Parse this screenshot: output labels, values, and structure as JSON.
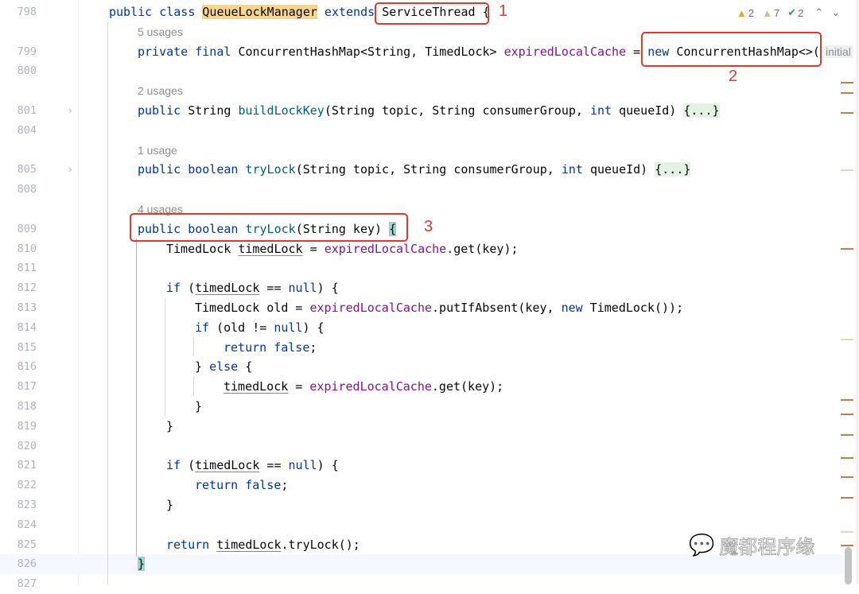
{
  "inspections": {
    "warnings": "2",
    "weak_warnings": "7",
    "typos": "2"
  },
  "annotations": [
    "1",
    "2",
    "3"
  ],
  "watermark": "魔都程序缘",
  "hint": "initial",
  "rows": [
    {
      "n": "798",
      "i": 0,
      "t": [
        [
          "k",
          "public class "
        ],
        [
          "cls",
          "QueueLockManager"
        ],
        [
          "k",
          " extends "
        ],
        [
          "p",
          "ServiceThread {"
        ]
      ]
    },
    {
      "usage": "5 usages",
      "i": 1
    },
    {
      "n": "799",
      "i": 1,
      "t": [
        [
          "k",
          "private final "
        ],
        [
          "p",
          "ConcurrentHashMap<String, TimedLock> "
        ],
        [
          "f",
          "expiredLocalCache"
        ],
        [
          "p",
          " = "
        ],
        [
          "k",
          "new "
        ],
        [
          "p",
          "ConcurrentHashMap<>("
        ]
      ],
      "hint": true
    },
    {
      "n": "800",
      "i": 1,
      "t": []
    },
    {
      "usage": "2 usages",
      "i": 1
    },
    {
      "n": "801",
      "i": 1,
      "fold": true,
      "t": [
        [
          "k",
          "public "
        ],
        [
          "p",
          "String "
        ],
        [
          "m",
          "buildLockKey"
        ],
        [
          "p",
          "(String topic, String consumerGroup, "
        ],
        [
          "k",
          "int "
        ],
        [
          "p",
          "queueId) "
        ],
        [
          "fb",
          "{...}"
        ]
      ]
    },
    {
      "n": "804",
      "i": 1,
      "t": []
    },
    {
      "usage": "1 usage",
      "i": 1
    },
    {
      "n": "805",
      "i": 1,
      "fold": true,
      "t": [
        [
          "k",
          "public boolean "
        ],
        [
          "m",
          "tryLock"
        ],
        [
          "p",
          "(String topic, String consumerGroup, "
        ],
        [
          "k",
          "int "
        ],
        [
          "p",
          "queueId) "
        ],
        [
          "fb",
          "{...}"
        ]
      ]
    },
    {
      "n": "808",
      "i": 1,
      "t": []
    },
    {
      "usage": "4 usages",
      "i": 1
    },
    {
      "n": "809",
      "i": 1,
      "t": [
        [
          "k",
          "public boolean "
        ],
        [
          "m",
          "tryLock"
        ],
        [
          "p",
          "(String key) "
        ],
        [
          "hl",
          "{"
        ]
      ]
    },
    {
      "n": "810",
      "i": 2,
      "t": [
        [
          "p",
          "TimedLock "
        ],
        [
          "v",
          "timedLock"
        ],
        [
          "p",
          " = "
        ],
        [
          "f",
          "expiredLocalCache"
        ],
        [
          "p",
          ".get(key);"
        ]
      ]
    },
    {
      "n": "811",
      "i": 2,
      "t": []
    },
    {
      "n": "812",
      "i": 2,
      "t": [
        [
          "k",
          "if "
        ],
        [
          "p",
          "("
        ],
        [
          "v",
          "timedLock"
        ],
        [
          "p",
          " == "
        ],
        [
          "k",
          "null"
        ],
        [
          "p",
          ") {"
        ]
      ]
    },
    {
      "n": "813",
      "i": 3,
      "t": [
        [
          "p",
          "TimedLock old = "
        ],
        [
          "f",
          "expiredLocalCache"
        ],
        [
          "p",
          ".putIfAbsent(key, "
        ],
        [
          "k",
          "new "
        ],
        [
          "p",
          "TimedLock());"
        ]
      ]
    },
    {
      "n": "814",
      "i": 3,
      "t": [
        [
          "k",
          "if "
        ],
        [
          "p",
          "(old != "
        ],
        [
          "k",
          "null"
        ],
        [
          "p",
          ") {"
        ]
      ]
    },
    {
      "n": "815",
      "i": 4,
      "t": [
        [
          "k",
          "return false"
        ],
        [
          "p",
          ";"
        ]
      ]
    },
    {
      "n": "816",
      "i": 3,
      "t": [
        [
          "p",
          "} "
        ],
        [
          "k",
          "else "
        ],
        [
          "p",
          "{"
        ]
      ]
    },
    {
      "n": "817",
      "i": 4,
      "t": [
        [
          "v",
          "timedLock"
        ],
        [
          "p",
          " = "
        ],
        [
          "f",
          "expiredLocalCache"
        ],
        [
          "p",
          ".get(key);"
        ]
      ]
    },
    {
      "n": "818",
      "i": 3,
      "t": [
        [
          "p",
          "}"
        ]
      ]
    },
    {
      "n": "819",
      "i": 2,
      "t": [
        [
          "p",
          "}"
        ]
      ]
    },
    {
      "n": "820",
      "i": 2,
      "t": []
    },
    {
      "n": "821",
      "i": 2,
      "t": [
        [
          "k",
          "if "
        ],
        [
          "p",
          "("
        ],
        [
          "v",
          "timedLock"
        ],
        [
          "p",
          " == "
        ],
        [
          "k",
          "null"
        ],
        [
          "p",
          ") {"
        ]
      ]
    },
    {
      "n": "822",
      "i": 3,
      "t": [
        [
          "k",
          "return false"
        ],
        [
          "p",
          ";"
        ]
      ]
    },
    {
      "n": "823",
      "i": 2,
      "t": [
        [
          "p",
          "}"
        ]
      ]
    },
    {
      "n": "824",
      "i": 2,
      "t": []
    },
    {
      "n": "825",
      "i": 2,
      "t": [
        [
          "k",
          "return "
        ],
        [
          "v",
          "timedLock"
        ],
        [
          "p",
          ".tryLock();"
        ]
      ]
    },
    {
      "n": "826",
      "i": 1,
      "current": true,
      "t": [
        [
          "hl",
          "}"
        ]
      ]
    },
    {
      "n": "827",
      "i": 0,
      "t": []
    }
  ]
}
